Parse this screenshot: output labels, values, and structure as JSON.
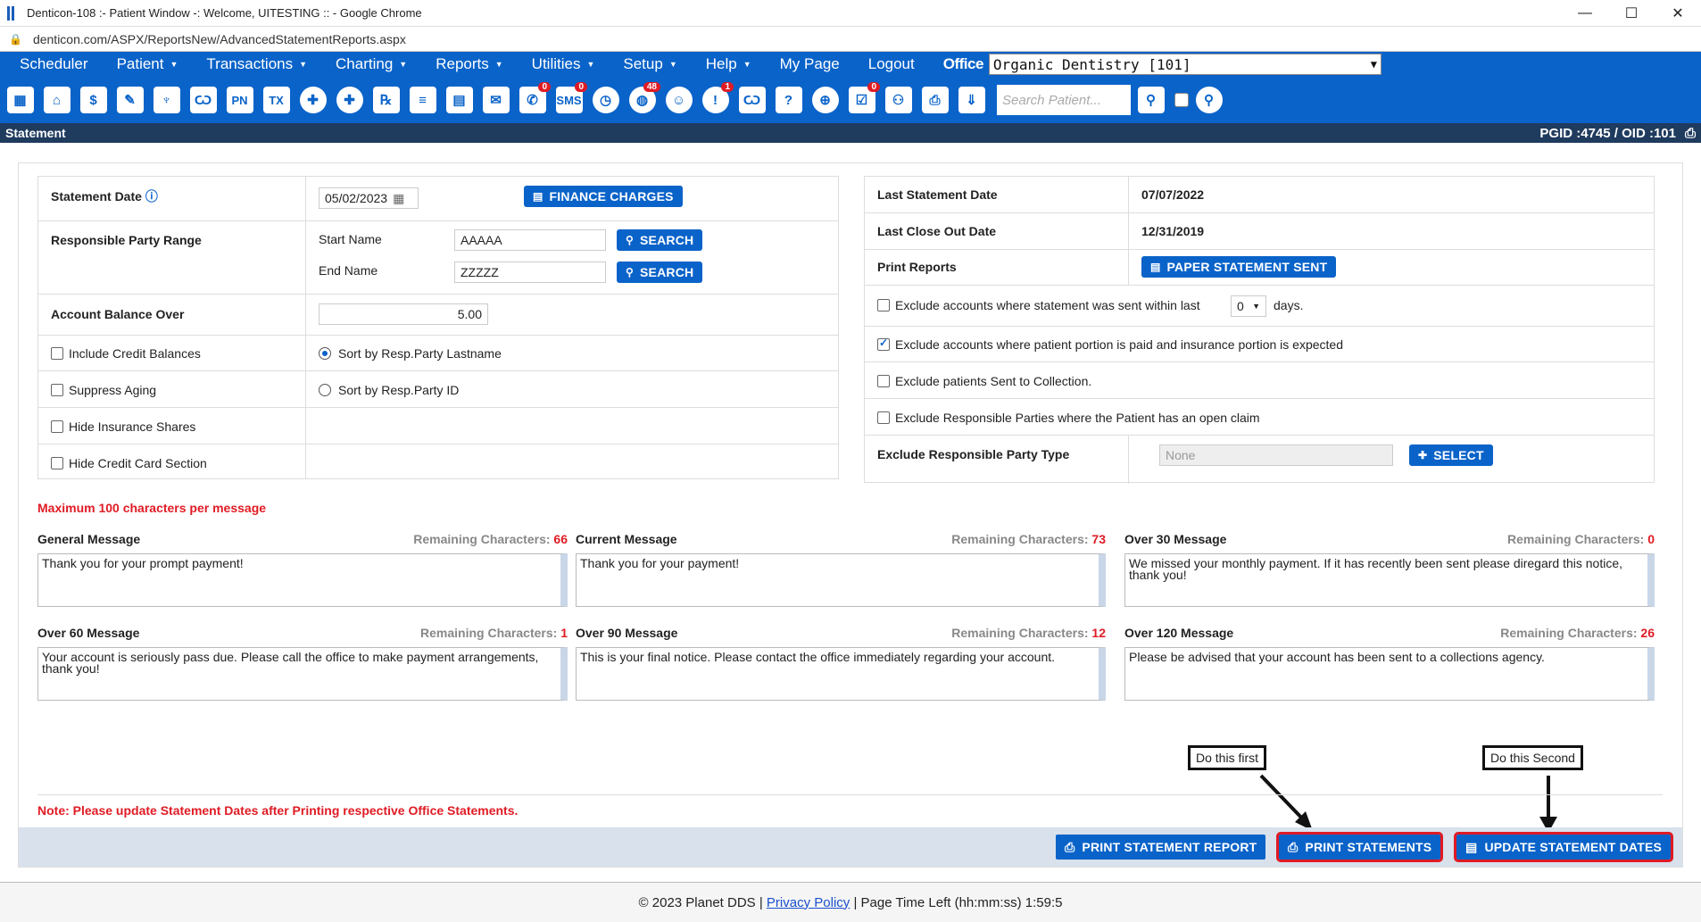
{
  "window": {
    "title": "Denticon-108 :- Patient Window -: Welcome, UITESTING :: - Google Chrome",
    "url": "denticon.com/ASPX/ReportsNew/AdvancedStatementReports.aspx"
  },
  "menu": {
    "items": [
      "Scheduler",
      "Patient",
      "Transactions",
      "Charting",
      "Reports",
      "Utilities",
      "Setup",
      "Help",
      "My Page",
      "Logout"
    ],
    "office_label": "Office",
    "office_value": "Organic Dentistry [101]"
  },
  "toolbar": {
    "badges": {
      "sms": "0",
      "globe": "48",
      "alert": "1",
      "doc": "0",
      "misc": "0"
    },
    "search_placeholder": "Search Patient..."
  },
  "subheader": {
    "title": "Statement",
    "pgid": "PGID :4745  /  OID :101"
  },
  "left": {
    "statement_date_label": "Statement Date",
    "statement_date": "05/02/2023",
    "finance_charges": "FINANCE CHARGES",
    "resp_range_label": "Responsible Party Range",
    "start_name_label": "Start Name",
    "start_name": "AAAAA",
    "end_name_label": "End Name",
    "end_name": "ZZZZZ",
    "search": "SEARCH",
    "balance_over_label": "Account Balance Over",
    "balance_over": "5.00",
    "include_credit": "Include Credit Balances",
    "sort_lastname": "Sort by Resp.Party Lastname",
    "suppress_aging": "Suppress Aging",
    "sort_id": "Sort by Resp.Party ID",
    "hide_insurance": "Hide Insurance Shares",
    "hide_cc": "Hide Credit Card Section"
  },
  "right": {
    "last_statement_label": "Last Statement Date",
    "last_statement": "07/07/2022",
    "last_closeout_label": "Last Close Out Date",
    "last_closeout": "12/31/2019",
    "print_reports_label": "Print Reports",
    "paper_sent": "PAPER STATEMENT SENT",
    "exclude_sent_a": "Exclude accounts where statement was sent within last",
    "exclude_sent_days": "0",
    "exclude_sent_b": "days.",
    "exclude_portion": "Exclude accounts where patient portion is paid and insurance portion is expected",
    "exclude_collection": "Exclude patients Sent to Collection.",
    "exclude_open_claim": "Exclude Responsible Parties where the Patient has an open claim",
    "exclude_type_label": "Exclude Responsible Party Type",
    "exclude_type_value": "None",
    "select": "SELECT"
  },
  "messages": {
    "max_note": "Maximum 100 characters per message",
    "rc_label": "Remaining Characters:",
    "items": [
      {
        "title": "General Message",
        "remaining": "66",
        "text": "Thank you for your prompt payment!"
      },
      {
        "title": "Current Message",
        "remaining": "73",
        "text": "Thank you for your payment!"
      },
      {
        "title": "Over 30 Message",
        "remaining": "0",
        "text": "We missed your monthly payment. If it has recently been sent please diregard this notice, thank you!"
      },
      {
        "title": "Over 60 Message",
        "remaining": "1",
        "text": "Your account is seriously pass due. Please call the office to make payment arrangements, thank you!"
      },
      {
        "title": "Over 90 Message",
        "remaining": "12",
        "text": "This is your final notice. Please contact the office immediately regarding your account."
      },
      {
        "title": "Over 120 Message",
        "remaining": "26",
        "text": "Please be advised that your account has been sent to a collections agency."
      }
    ]
  },
  "note": "Note: Please update Statement Dates after Printing respective Office Statements.",
  "callouts": {
    "first": "Do this first",
    "second": "Do this Second"
  },
  "footer_buttons": {
    "print_report": "PRINT STATEMENT REPORT",
    "print_statements": "PRINT STATEMENTS",
    "update_dates": "UPDATE STATEMENT DATES"
  },
  "page_footer": {
    "copyright": "© 2023 Planet DDS |",
    "privacy": "Privacy Policy",
    "time_left": "| Page Time Left (hh:mm:ss) 1:59:5"
  }
}
